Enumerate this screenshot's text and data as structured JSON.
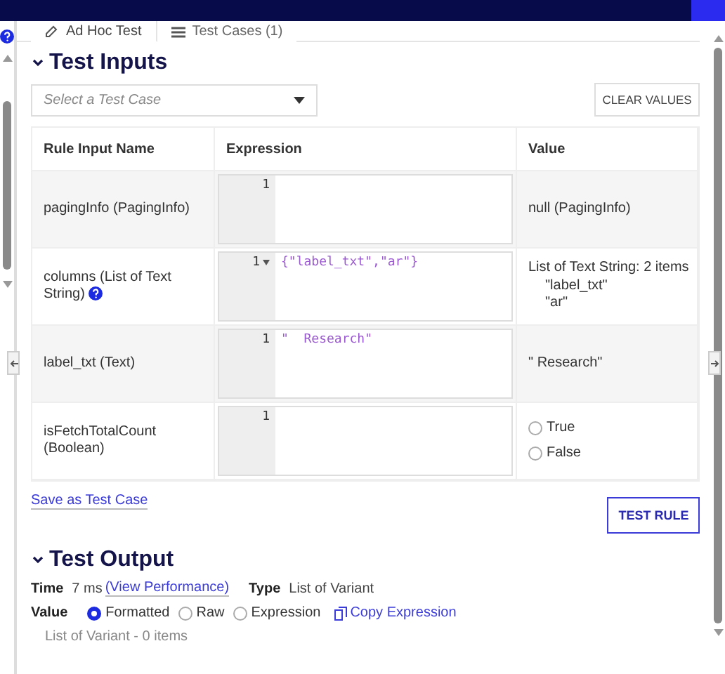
{
  "tabs": [
    {
      "label": "Ad Hoc Test",
      "kind": "edit",
      "selected": true
    },
    {
      "label": "Test Cases (1)",
      "kind": "list",
      "selected": false
    }
  ],
  "test_inputs": {
    "title": "Test Inputs",
    "expanded": true,
    "select": {
      "placeholder": "Select a Test Case"
    },
    "clear_button": "CLEAR VALUES",
    "columns": [
      "Rule Input Name",
      "Expression",
      "Value"
    ],
    "rows": [
      {
        "name": "pagingInfo (PagingInfo)",
        "help": false,
        "line": "1",
        "foldable": false,
        "code": "",
        "kind": "text",
        "value": "null (PagingInfo)"
      },
      {
        "name": "columns (List of Text String)",
        "help": true,
        "line": "1",
        "foldable": true,
        "code": "{\"label_txt\",\"ar\"}",
        "kind": "list",
        "value": "List of Text String: 2 items",
        "items": [
          "\"label_txt\"",
          "\"ar\""
        ]
      },
      {
        "name": "label_txt (Text)",
        "help": false,
        "line": "1",
        "foldable": false,
        "code": "\"  Research\"",
        "kind": "text",
        "value": "\" Research\""
      },
      {
        "name": "isFetchTotalCount (Boolean)",
        "help": false,
        "line": "1",
        "foldable": false,
        "code": "",
        "kind": "radio",
        "options": [
          {
            "label": "True",
            "selected": false
          },
          {
            "label": "False",
            "selected": false
          }
        ]
      }
    ],
    "save_link": "Save as Test Case",
    "test_button": "TEST RULE"
  },
  "test_output": {
    "title": "Test Output",
    "expanded": true,
    "time_label": "Time",
    "time_value": "7 ms",
    "perf_link": "(View Performance)",
    "type_label": "Type",
    "type_value": "List of Variant",
    "value_label": "Value",
    "view_options": [
      {
        "label": "Formatted",
        "selected": true
      },
      {
        "label": "Raw",
        "selected": false
      },
      {
        "label": "Expression",
        "selected": false
      }
    ],
    "copy_link": "Copy Expression",
    "result": "List of Variant - 0 items"
  }
}
